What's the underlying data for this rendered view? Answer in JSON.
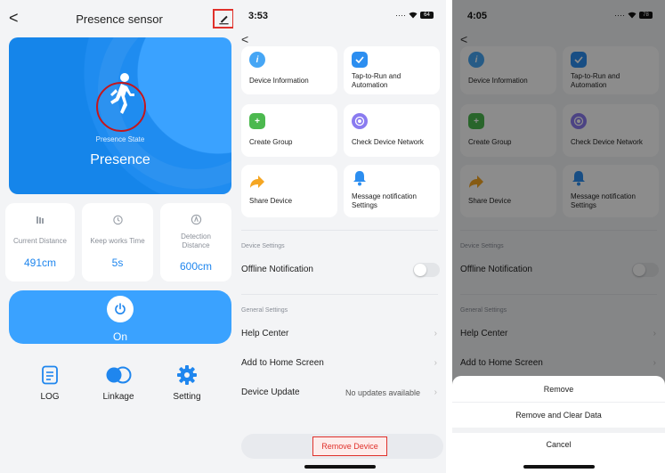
{
  "panel1": {
    "title": "Presence sensor",
    "back": "<",
    "state_label": "Presence State",
    "state_value": "Presence",
    "stats": [
      {
        "label": "Current Distance",
        "value": "491cm"
      },
      {
        "label": "Keep works Time",
        "value": "5s"
      },
      {
        "label": "Detection\nDistance",
        "value": "600cm"
      }
    ],
    "power_label": "On",
    "actions": [
      {
        "label": "LOG"
      },
      {
        "label": "Linkage"
      },
      {
        "label": "Setting"
      }
    ],
    "colors": {
      "accent": "#1f86ee",
      "hero": "#1f8cf0",
      "highlight": "#e0312b"
    }
  },
  "panel2": {
    "time": "3:53",
    "battery": "64",
    "tiles": [
      {
        "label": "Device Information"
      },
      {
        "label": "Tap-to-Run and Automation"
      },
      {
        "label": "Create Group"
      },
      {
        "label": "Check Device Network"
      },
      {
        "label": "Share Device"
      },
      {
        "label": "Message notification Settings"
      }
    ],
    "device_settings_label": "Device Settings",
    "offline_notification": "Offline Notification",
    "general_settings_label": "General Settings",
    "help_center": "Help Center",
    "add_to_home": "Add to Home Screen",
    "device_update": "Device Update",
    "no_updates": "No updates available",
    "remove_device": "Remove Device"
  },
  "panel3": {
    "time": "4:05",
    "battery": "78",
    "tiles": [
      {
        "label": "Device Information"
      },
      {
        "label": "Tap-to-Run and Automation"
      },
      {
        "label": "Create Group"
      },
      {
        "label": "Check Device Network"
      },
      {
        "label": "Share Device"
      },
      {
        "label": "Message notification Settings"
      }
    ],
    "device_settings_label": "Device Settings",
    "offline_notification": "Offline Notification",
    "general_settings_label": "General Settings",
    "help_center": "Help Center",
    "add_to_home": "Add to Home Screen",
    "sheet": {
      "remove": "Remove",
      "remove_clear": "Remove and Clear Data",
      "cancel": "Cancel"
    }
  }
}
